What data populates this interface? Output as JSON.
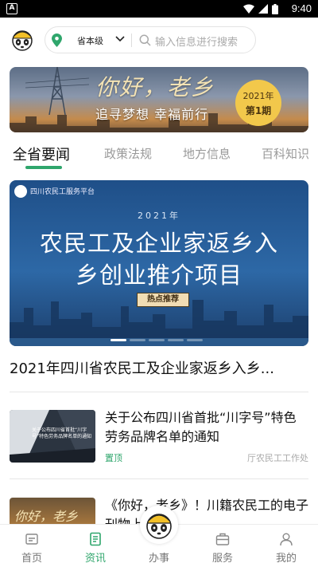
{
  "status_bar": {
    "notification_label": "A",
    "time": "9:40"
  },
  "header": {
    "region": "省本级",
    "search_placeholder": "输入信息进行搜索"
  },
  "banner": {
    "title": "你好，老乡",
    "subtitle": "追寻梦想 幸福前行",
    "issue_year": "2021年",
    "issue_no": "第1期"
  },
  "tabs": [
    {
      "label": "全省要闻",
      "active": true
    },
    {
      "label": "政策法规",
      "active": false
    },
    {
      "label": "地方信息",
      "active": false
    },
    {
      "label": "百科知识",
      "active": false
    }
  ],
  "feature": {
    "platform": "四川农民工服务平台",
    "year": "2021年",
    "headline_line1": "农民工及企业家返乡入",
    "headline_line2": "乡创业推介项目",
    "hot_badge": "热点推荐",
    "caption": "2021年四川省农民工及企业家返乡入乡...",
    "slides_total": 5,
    "slide_active_index": 0
  },
  "news": [
    {
      "title": "关于公布四川省首批“川字号”特色劳务品牌名单的通知",
      "tag": "置顶",
      "source": "厅农民工工作处",
      "thumb_text": "关于公布四川省首批“川字号”特色劳务品牌名单的通知"
    },
    {
      "title": "《你好，老乡》！川籍农民工的电子刊物上线啦！",
      "tag": "",
      "source": "",
      "thumb_text": "你好，老乡"
    }
  ],
  "bottom_nav": [
    {
      "label": "首页",
      "icon": "home-icon",
      "active": false
    },
    {
      "label": "资讯",
      "icon": "news-icon",
      "active": true
    },
    {
      "label": "办事",
      "icon": "panda-icon",
      "active": false
    },
    {
      "label": "服务",
      "icon": "briefcase-icon",
      "active": false
    },
    {
      "label": "我的",
      "icon": "user-icon",
      "active": false
    }
  ],
  "colors": {
    "accent": "#2fa66c",
    "banner_badge": "#f2c84b",
    "feature_blue": "#2d68a6"
  }
}
